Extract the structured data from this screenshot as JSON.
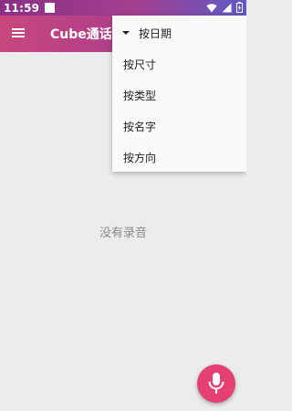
{
  "status_bar": {
    "time": "11:59"
  },
  "app_bar": {
    "title": "Cube通话录音"
  },
  "sort_menu": {
    "items": [
      {
        "label": "按日期",
        "selected": true
      },
      {
        "label": "按尺寸",
        "selected": false
      },
      {
        "label": "按类型",
        "selected": false
      },
      {
        "label": "按名字",
        "selected": false
      },
      {
        "label": "按方向",
        "selected": false
      }
    ]
  },
  "main": {
    "empty_text": "没有录音"
  },
  "icons": {
    "menu": "hamburger-menu-icon",
    "fab": "microphone-icon",
    "wifi": "wifi-icon",
    "signal": "signal-icon",
    "battery": "battery-icon"
  },
  "colors": {
    "fab": "#e63f72",
    "app_bar_start": "#c8477e",
    "app_bar_end": "#8a4aa8"
  }
}
